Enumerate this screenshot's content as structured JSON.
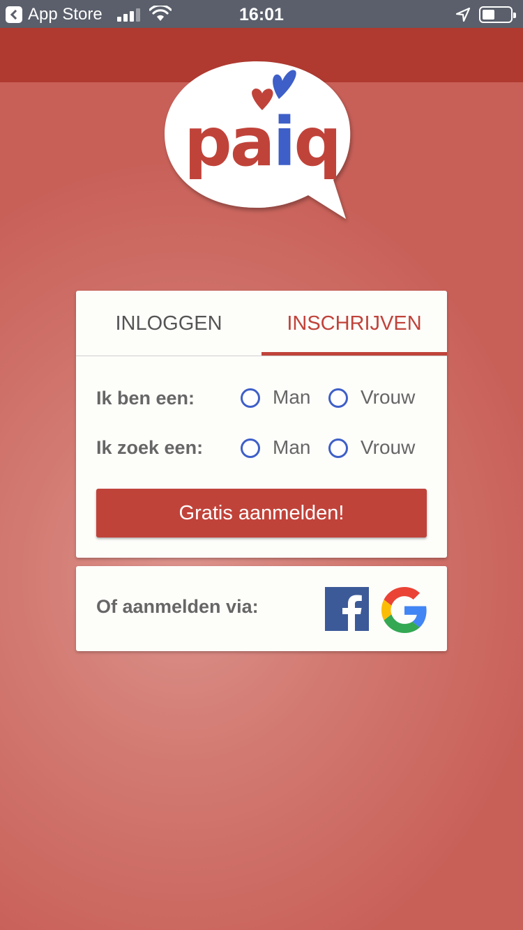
{
  "status_bar": {
    "back_label": "App Store",
    "time": "16:01",
    "battery_percent": 45
  },
  "logo": {
    "text": "paiq"
  },
  "tabs": [
    {
      "label": "INLOGGEN",
      "active": false
    },
    {
      "label": "INSCHRIJVEN",
      "active": true
    }
  ],
  "signup": {
    "i_am_label": "Ik ben een:",
    "seeking_label": "Ik zoek een:",
    "option_man": "Man",
    "option_woman": "Vrouw",
    "submit_label": "Gratis aanmelden!"
  },
  "social": {
    "label": "Of aanmelden via:",
    "providers": [
      "facebook-icon",
      "google-icon"
    ]
  },
  "colors": {
    "brand_red": "#c0433a",
    "brand_blue": "#3e5fc8",
    "facebook_blue": "#3c5a98"
  }
}
